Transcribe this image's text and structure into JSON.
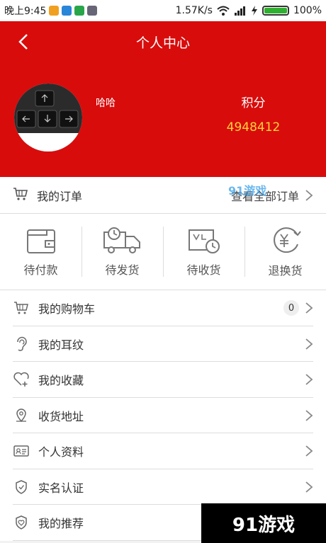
{
  "status_bar": {
    "time": "晚上9:45",
    "network_speed": "1.57K/s",
    "battery_percent": "100%",
    "battery_level": 1.0
  },
  "header": {
    "title": "个人中心",
    "username": "哈哈",
    "points_label": "积分",
    "points_value": "4948412"
  },
  "orders": {
    "title": "我的订单",
    "view_all": "查看全部订单"
  },
  "order_status": [
    {
      "label": "待付款",
      "icon": "wallet-icon"
    },
    {
      "label": "待发货",
      "icon": "truck-icon"
    },
    {
      "label": "待收货",
      "icon": "package-clock-icon"
    },
    {
      "label": "退换货",
      "icon": "yuan-refund-icon"
    }
  ],
  "menu": [
    {
      "label": "我的购物车",
      "icon": "cart-icon",
      "badge": "0"
    },
    {
      "label": "我的耳纹",
      "icon": "ear-icon"
    },
    {
      "label": "我的收藏",
      "icon": "heart-plus-icon"
    },
    {
      "label": "收货地址",
      "icon": "location-pin-icon"
    },
    {
      "label": "个人资料",
      "icon": "id-card-icon"
    },
    {
      "label": "实名认证",
      "icon": "shield-check-icon"
    },
    {
      "label": "我的推荐",
      "icon": "shield-heart-icon"
    }
  ],
  "watermarks": {
    "small": "91游戏",
    "corner": "91游戏"
  },
  "colors": {
    "header_red": "#d90c0c",
    "points_yellow": "#ffd23a"
  }
}
